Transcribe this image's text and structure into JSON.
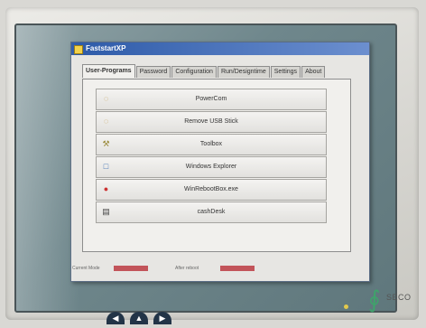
{
  "window": {
    "title": "FaststartXP"
  },
  "tabs": [
    {
      "label": "User-Programs",
      "active": true
    },
    {
      "label": "Password",
      "active": false
    },
    {
      "label": "Configuration",
      "active": false
    },
    {
      "label": "Run/Designtime",
      "active": false
    },
    {
      "label": "Settings",
      "active": false
    },
    {
      "label": "About",
      "active": false
    }
  ],
  "programs": [
    {
      "label": "PowerCom",
      "icon": "power-icon"
    },
    {
      "label": "Remove USB Stick",
      "icon": "usb-icon"
    },
    {
      "label": "Toolbox",
      "icon": "toolbox-icon"
    },
    {
      "label": "Windows Explorer",
      "icon": "explorer-icon"
    },
    {
      "label": "WinRebootBox.exe",
      "icon": "reboot-icon"
    },
    {
      "label": "cashDesk",
      "icon": "cashdesk-icon"
    }
  ],
  "status": {
    "left_label": "Current Mode",
    "right_label": "After reboot"
  },
  "hardware": {
    "logo_text": "SECO"
  },
  "colors": {
    "titlebar": "#2d5aa8",
    "status_indicator": "#c2545a"
  }
}
